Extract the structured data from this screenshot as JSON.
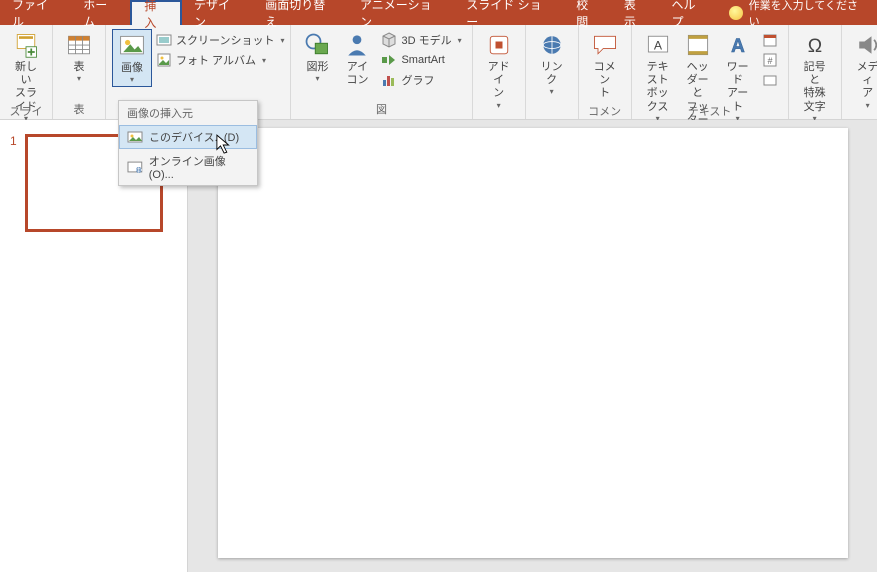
{
  "menubar": {
    "tabs": [
      "ファイル",
      "ホーム",
      "挿入",
      "デザイン",
      "画面切り替え",
      "アニメーション",
      "スライド ショー",
      "校閲",
      "表示",
      "ヘルプ"
    ],
    "active_index": 2,
    "tell_me": "作業を入力してください"
  },
  "ribbon": {
    "groups": {
      "slides": {
        "label": "スライド",
        "new_slide": "新しい\nスライド"
      },
      "tables": {
        "label": "表",
        "table": "表"
      },
      "images": {
        "label": "",
        "image": "画像",
        "screenshot": "スクリーンショット",
        "photo_album": "フォト アルバム"
      },
      "illust": {
        "label": "図",
        "shapes": "図形",
        "icons": "アイ\nコン",
        "model3d": "3D モデル",
        "smartart": "SmartArt",
        "chart": "グラフ"
      },
      "addins": {
        "label": "",
        "addin": "アドイ\nン"
      },
      "links": {
        "label": "",
        "link": "リン\nク"
      },
      "comments": {
        "label": "コメント",
        "comment": "コメン\nト"
      },
      "text": {
        "label": "テキスト",
        "textbox": "テキスト\nボックス",
        "headerfooter": "ヘッダーと\nフッター",
        "wordart": "ワード\nアート"
      },
      "symbols": {
        "label": "",
        "symbol": "記号と\n特殊文字"
      },
      "media": {
        "label": "",
        "media": "メディ\nア"
      }
    }
  },
  "dropdown": {
    "header": "画像の挿入元",
    "items": [
      "このデバイス...(D)",
      "オンライン画像(O)..."
    ],
    "hover_index": 0
  },
  "thumbs": {
    "slide1_number": "1"
  }
}
